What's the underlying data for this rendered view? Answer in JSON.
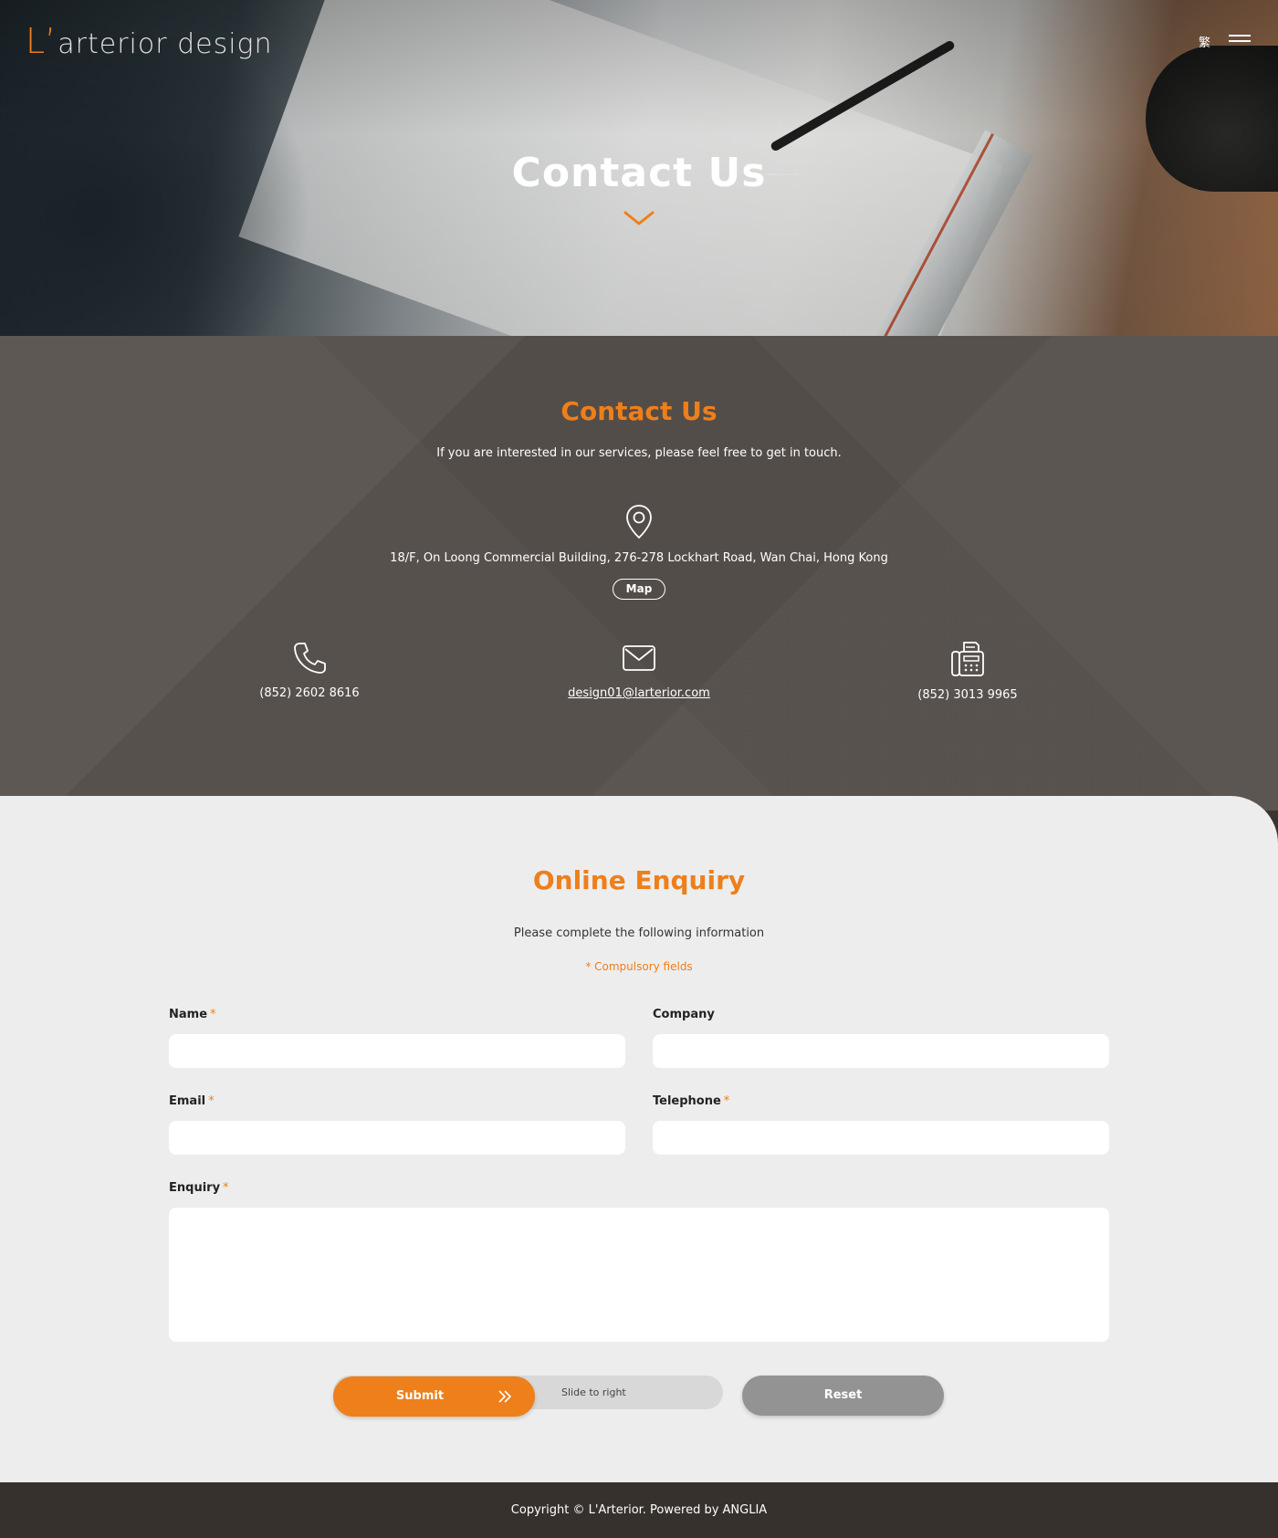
{
  "header": {
    "logo_mark": "L’",
    "logo_text": "arterior design",
    "lang_label": "繁"
  },
  "hero": {
    "title": "Contact Us"
  },
  "contact": {
    "title": "Contact Us",
    "subtitle": "If you are interested in our services, please feel free to get in touch.",
    "address": "18/F, On Loong Commercial Building, 276-278 Lockhart Road, Wan Chai, Hong Kong",
    "map_label": "Map",
    "phone": "(852) 2602 8616",
    "email": "design01@larterior.com",
    "fax": "(852) 3013 9965"
  },
  "enquiry": {
    "title": "Online Enquiry",
    "subtitle": "Please complete the following information",
    "required_note": "* Compulsory fields",
    "fields": {
      "name": {
        "label": "Name",
        "star": "*",
        "value": ""
      },
      "company": {
        "label": "Company",
        "value": ""
      },
      "email": {
        "label": "Email",
        "star": "*",
        "value": ""
      },
      "telephone": {
        "label": "Telephone",
        "star": "*",
        "value": ""
      },
      "enquiry": {
        "label": "Enquiry",
        "star": "*",
        "value": ""
      }
    },
    "submit_label": "Submit",
    "slide_hint": "Slide to right",
    "reset_label": "Reset"
  },
  "footer": {
    "copyright": "Copyright © L'Arterior. Powered by ANGLIA"
  },
  "colors": {
    "accent": "#ee7f1a",
    "contact_bg": "#57514d",
    "form_bg": "#ededed",
    "footer_bg": "#37312d",
    "reset_bg": "#939393"
  }
}
